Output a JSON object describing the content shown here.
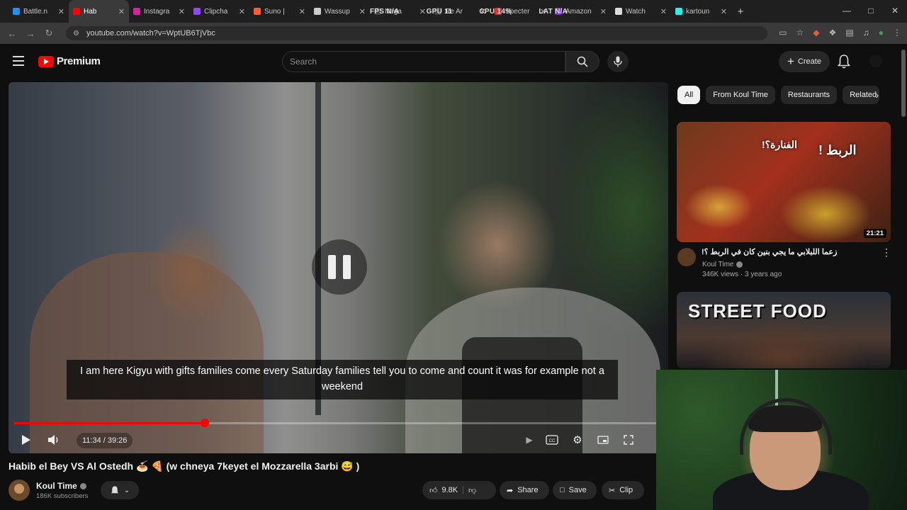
{
  "browser": {
    "tabs": [
      {
        "label": "Battle.n",
        "color": "#1e90ff",
        "active": false
      },
      {
        "label": "Hab",
        "color": "#ff0000",
        "active": true
      },
      {
        "label": "Instagra",
        "color": "#d6249f",
        "active": false
      },
      {
        "label": "Clipcha",
        "color": "#9146ff",
        "active": false
      },
      {
        "label": "Suno |",
        "color": "#ff5c33",
        "active": false
      },
      {
        "label": "Wassup",
        "color": "#cccccc",
        "active": false
      },
      {
        "label": "Nega",
        "color": "#444444",
        "active": false
      },
      {
        "label": "Re Ar",
        "color": "#444444",
        "active": false
      },
      {
        "label": "Specter",
        "color": "#e03030",
        "active": false
      },
      {
        "label": "Amazon",
        "color": "#7d2ae8",
        "active": false
      },
      {
        "label": "Watch",
        "color": "#dddddd",
        "active": false
      },
      {
        "label": "kartoun",
        "color": "#25f4ee",
        "active": false
      }
    ],
    "new_tab_label": "+",
    "hud": {
      "fps": "FPS N/A",
      "gpu": "GPU 11",
      "cpu": "CPU 14%",
      "lat": "LAT N/A"
    },
    "url": "youtube.com/watch?v=WptUB6TjVbc"
  },
  "header": {
    "logo_text": "Premium",
    "search_placeholder": "Search",
    "create_label": "Create",
    "colors": {
      "brand": "#ff0000",
      "background": "#0f0f0f",
      "chip_bg": "#272727"
    }
  },
  "player": {
    "caption": "I am here Kigyu with gifts families come every Saturday families tell you to come and count it was for example not a weekend",
    "timecode": "11:34 / 39:26",
    "progress": 0.2936,
    "state": "paused-overlay"
  },
  "video": {
    "title": "Habib el Bey VS Al Ostedh 🍝 🍕 (w chneya 7keyet el Mozzarella 3arbi 😅 )",
    "channel": "Koul Time",
    "subscribers": "186K subscribers",
    "actions": {
      "likes": "9.8K",
      "share": "Share",
      "save": "Save",
      "clip": "Clip"
    }
  },
  "sidebar": {
    "chips": [
      "All",
      "From Koul Time",
      "Restaurants",
      "Related"
    ],
    "recommendations": [
      {
        "title": "زعما اللبلابي ما يجي بنين كان في الربط ؟!",
        "thumb_text": "الربط !",
        "thumb_text_2": "الفنارة؟!",
        "channel": "Koul Time",
        "meta": "346K views · 3 years ago",
        "duration": "21:21"
      },
      {
        "thumb_text": "STREET FOOD"
      }
    ]
  }
}
